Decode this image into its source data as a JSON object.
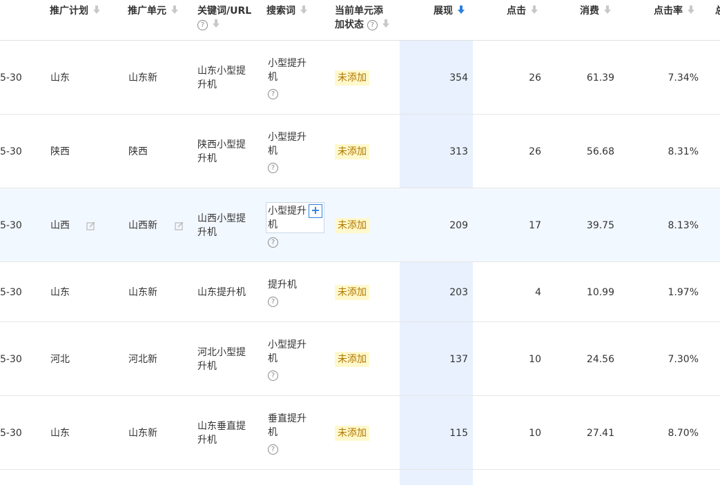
{
  "colors": {
    "accent": "#2b7fe0",
    "sort_column_bg": "#e8f1fd",
    "badge_bg": "#fff8cc",
    "badge_text": "#b07700"
  },
  "columns": {
    "plan": "推广计划",
    "unit": "推广单元",
    "keyword": "关键词/URL",
    "search_term": "搜索词",
    "status_line1": "当前单元添",
    "status_line2": "加状态",
    "impressions": "展现",
    "clicks": "点击",
    "cost": "消费",
    "ctr": "点击率",
    "overflow": "总"
  },
  "rows": [
    {
      "date": "5-30",
      "plan": "山东",
      "unit": "山东新",
      "keyword_l1": "山东小型提",
      "keyword_l2": "升机",
      "term_l1": "小型提升",
      "term_l2": "机",
      "status": "未添加",
      "impressions": "354",
      "clicks": "26",
      "cost": "61.39",
      "ctr": "7.34%"
    },
    {
      "date": "5-30",
      "plan": "陕西",
      "unit": "陕西",
      "keyword_l1": "陕西小型提",
      "keyword_l2": "升机",
      "term_l1": "小型提升",
      "term_l2": "机",
      "status": "未添加",
      "impressions": "313",
      "clicks": "26",
      "cost": "56.68",
      "ctr": "8.31%"
    },
    {
      "date": "5-30",
      "plan": "山西",
      "unit": "山西新",
      "keyword_l1": "山西小型提",
      "keyword_l2": "升机",
      "term_l1": "小型提升",
      "term_l2": "机",
      "status": "未添加",
      "impressions": "209",
      "clicks": "17",
      "cost": "39.75",
      "ctr": "8.13%"
    },
    {
      "date": "5-30",
      "plan": "山东",
      "unit": "山东新",
      "keyword_l1": "山东提升机",
      "keyword_l2": "",
      "term_l1": "提升机",
      "term_l2": "",
      "status": "未添加",
      "impressions": "203",
      "clicks": "4",
      "cost": "10.99",
      "ctr": "1.97%"
    },
    {
      "date": "5-30",
      "plan": "河北",
      "unit": "河北新",
      "keyword_l1": "河北小型提",
      "keyword_l2": "升机",
      "term_l1": "小型提升",
      "term_l2": "机",
      "status": "未添加",
      "impressions": "137",
      "clicks": "10",
      "cost": "24.56",
      "ctr": "7.30%"
    },
    {
      "date": "5-30",
      "plan": "山东",
      "unit": "山东新",
      "keyword_l1": "山东垂直提",
      "keyword_l2": "升机",
      "term_l1": "垂直提升",
      "term_l2": "机",
      "status": "未添加",
      "impressions": "115",
      "clicks": "10",
      "cost": "27.41",
      "ctr": "8.70%"
    }
  ],
  "icons": {
    "sort_arrow": "arrow-down-icon",
    "help": "question-icon",
    "edit": "edit-icon",
    "add": "plus-icon"
  },
  "sort": {
    "column": "impressions",
    "direction": "desc"
  }
}
